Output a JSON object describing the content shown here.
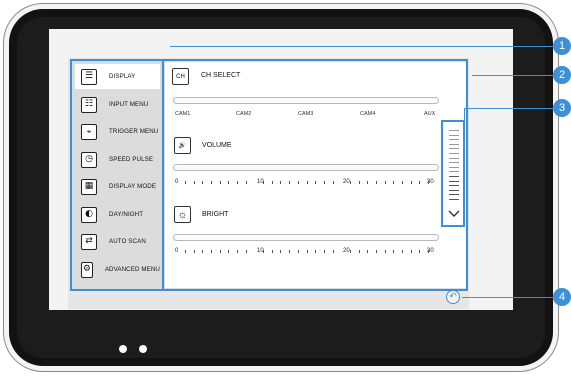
{
  "sidebar": {
    "items": [
      {
        "label": "DISPLAY",
        "icon": "display-icon",
        "active": true
      },
      {
        "label": "INPUT MENU",
        "icon": "input-menu-icon"
      },
      {
        "label": "TRIGGER MENU",
        "icon": "trigger-icon"
      },
      {
        "label": "SPEED PULSE",
        "icon": "speedometer-icon"
      },
      {
        "label": "DISPLAY MODE",
        "icon": "display-mode-icon"
      },
      {
        "label": "DAY/NIGHT",
        "icon": "day-night-icon"
      },
      {
        "label": "AUTO SCAN",
        "icon": "auto-scan-icon"
      },
      {
        "label": "ADVANCED MENU",
        "icon": "gear-icon"
      }
    ]
  },
  "ch_select": {
    "icon_text": "CH",
    "title": "CH SELECT",
    "options": [
      "CAM1",
      "CAM2",
      "CAM3",
      "CAM4",
      "AUX"
    ]
  },
  "volume": {
    "title": "VOLUME",
    "labels": [
      "0",
      "10",
      "20",
      "30"
    ]
  },
  "bright": {
    "title": "BRIGHT",
    "labels": [
      "0",
      "10",
      "20",
      "30"
    ]
  },
  "callouts": [
    "1",
    "2",
    "3",
    "4"
  ],
  "colors": {
    "accent": "#3d8fd8",
    "bezel": "#121212",
    "screen": "#f3f3f3"
  }
}
